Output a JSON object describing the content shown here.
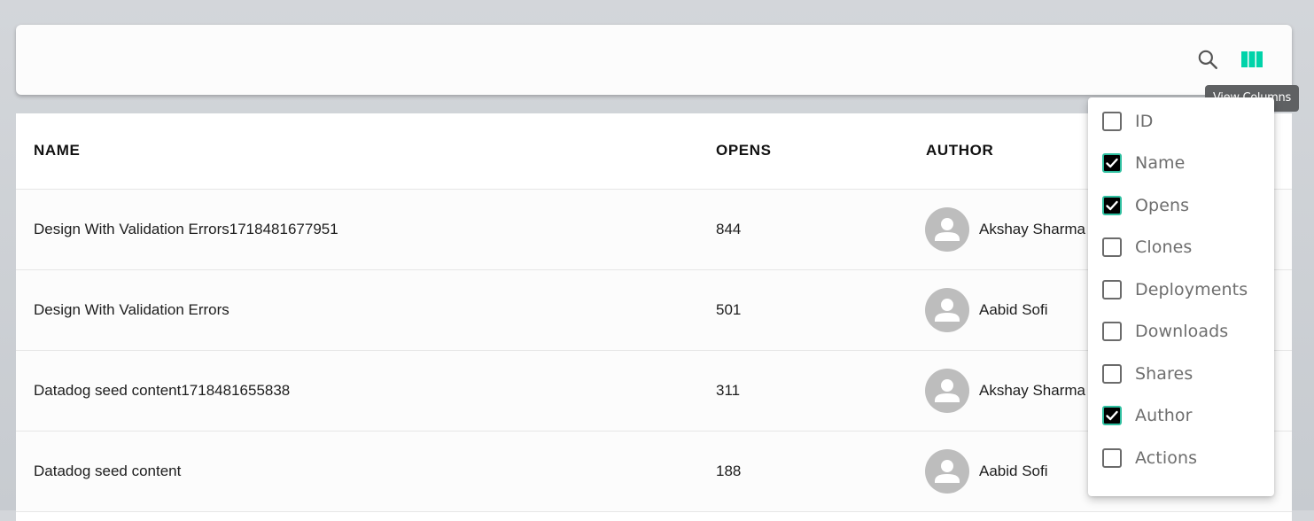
{
  "toolbar": {
    "search_icon": "search-icon",
    "columns_icon": "view-columns-icon",
    "tooltip": "View Columns",
    "accent_color": "#00d3a9"
  },
  "table": {
    "headers": {
      "name": "NAME",
      "opens": "OPENS",
      "author": "AUTHOR"
    },
    "rows": [
      {
        "name": "Design With Validation Errors1718481677951",
        "opens": "844",
        "author": "Akshay Sharma"
      },
      {
        "name": "Design With Validation Errors",
        "opens": "501",
        "author": "Aabid Sofi"
      },
      {
        "name": "Datadog seed content1718481655838",
        "opens": "311",
        "author": "Akshay Sharma"
      },
      {
        "name": "Datadog seed content",
        "opens": "188",
        "author": "Aabid Sofi"
      }
    ]
  },
  "columns_menu": {
    "options": [
      {
        "label": "ID",
        "checked": false
      },
      {
        "label": "Name",
        "checked": true
      },
      {
        "label": "Opens",
        "checked": true
      },
      {
        "label": "Clones",
        "checked": false
      },
      {
        "label": "Deployments",
        "checked": false
      },
      {
        "label": "Downloads",
        "checked": false
      },
      {
        "label": "Shares",
        "checked": false
      },
      {
        "label": "Author",
        "checked": true
      },
      {
        "label": "Actions",
        "checked": false
      }
    ]
  }
}
